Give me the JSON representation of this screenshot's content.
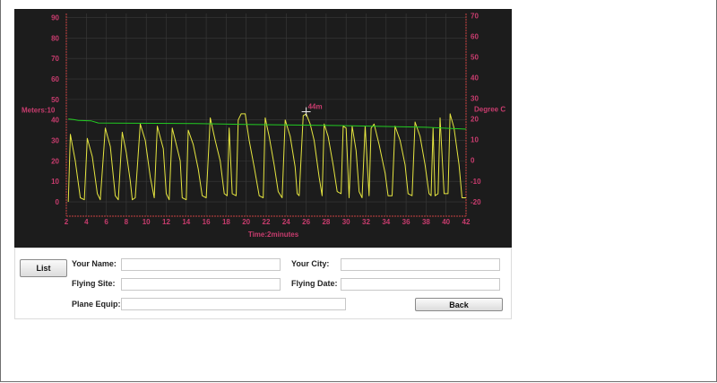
{
  "chart_data": {
    "type": "line",
    "left_axis": {
      "label": "Meters:10",
      "ticks": [
        0,
        10,
        20,
        30,
        40,
        50,
        60,
        70,
        80,
        90
      ],
      "range": [
        -7,
        92
      ]
    },
    "right_axis": {
      "label": "Degree C",
      "ticks": [
        -20,
        -10,
        0,
        10,
        20,
        30,
        40,
        50,
        60,
        70
      ],
      "range": [
        -27,
        71
      ]
    },
    "x_axis": {
      "label": "Time:2minutes",
      "ticks": [
        2,
        4,
        6,
        8,
        10,
        12,
        14,
        16,
        18,
        20,
        22,
        24,
        26,
        28,
        30,
        32,
        34,
        36,
        38,
        40,
        42
      ],
      "range": [
        2,
        42
      ]
    },
    "grid": true,
    "annotation": {
      "text": "44m",
      "x": 26.0,
      "y": 44
    },
    "series": [
      {
        "axis": "left",
        "color": "#e6e640",
        "points": [
          [
            2.2,
            0
          ],
          [
            2.4,
            33
          ],
          [
            2.9,
            20
          ],
          [
            3.4,
            2
          ],
          [
            3.8,
            1
          ],
          [
            4.1,
            31
          ],
          [
            4.6,
            22
          ],
          [
            5.1,
            4
          ],
          [
            5.4,
            1
          ],
          [
            5.9,
            36
          ],
          [
            6.4,
            27
          ],
          [
            6.9,
            3
          ],
          [
            7.2,
            1
          ],
          [
            7.6,
            34
          ],
          [
            8.0,
            24
          ],
          [
            8.4,
            10
          ],
          [
            8.6,
            1
          ],
          [
            8.9,
            2
          ],
          [
            9.4,
            38
          ],
          [
            9.9,
            30
          ],
          [
            10.4,
            12
          ],
          [
            10.8,
            2
          ],
          [
            11.1,
            37
          ],
          [
            11.7,
            26
          ],
          [
            12.0,
            4
          ],
          [
            12.3,
            1
          ],
          [
            12.6,
            36
          ],
          [
            13.0,
            28
          ],
          [
            13.4,
            20
          ],
          [
            13.6,
            2
          ],
          [
            14.0,
            1
          ],
          [
            14.2,
            35
          ],
          [
            14.7,
            28
          ],
          [
            15.2,
            16
          ],
          [
            15.6,
            3
          ],
          [
            16.0,
            2
          ],
          [
            16.4,
            41
          ],
          [
            16.9,
            30
          ],
          [
            17.4,
            20
          ],
          [
            17.8,
            4
          ],
          [
            18.1,
            3
          ],
          [
            18.3,
            36
          ],
          [
            18.6,
            4
          ],
          [
            19.0,
            3
          ],
          [
            19.2,
            40
          ],
          [
            19.5,
            43
          ],
          [
            19.9,
            43
          ],
          [
            20.3,
            30
          ],
          [
            20.8,
            17
          ],
          [
            21.3,
            3
          ],
          [
            21.7,
            2
          ],
          [
            21.9,
            41
          ],
          [
            22.3,
            32
          ],
          [
            22.8,
            18
          ],
          [
            23.2,
            5
          ],
          [
            23.6,
            2
          ],
          [
            23.9,
            40
          ],
          [
            24.4,
            32
          ],
          [
            24.9,
            17
          ],
          [
            25.1,
            4
          ],
          [
            25.3,
            3
          ],
          [
            25.7,
            42
          ],
          [
            26.0,
            43
          ],
          [
            26.4,
            38
          ],
          [
            26.8,
            30
          ],
          [
            27.3,
            12
          ],
          [
            27.6,
            3
          ],
          [
            27.8,
            38
          ],
          [
            28.2,
            32
          ],
          [
            28.7,
            18
          ],
          [
            29.1,
            5
          ],
          [
            29.5,
            4
          ],
          [
            29.7,
            37
          ],
          [
            30.0,
            36
          ],
          [
            30.3,
            2
          ],
          [
            30.6,
            37
          ],
          [
            31.0,
            25
          ],
          [
            31.3,
            5
          ],
          [
            31.6,
            2
          ],
          [
            31.9,
            37
          ],
          [
            32.3,
            3
          ],
          [
            32.5,
            36
          ],
          [
            32.8,
            38
          ],
          [
            33.3,
            28
          ],
          [
            33.9,
            14
          ],
          [
            34.2,
            3
          ],
          [
            34.6,
            3
          ],
          [
            34.9,
            37
          ],
          [
            35.4,
            30
          ],
          [
            35.9,
            18
          ],
          [
            36.2,
            4
          ],
          [
            36.6,
            3
          ],
          [
            36.9,
            39
          ],
          [
            37.4,
            32
          ],
          [
            37.9,
            18
          ],
          [
            38.3,
            4
          ],
          [
            38.5,
            3
          ],
          [
            38.7,
            36
          ],
          [
            38.9,
            3
          ],
          [
            39.2,
            4
          ],
          [
            39.4,
            41
          ],
          [
            39.8,
            4
          ],
          [
            40.2,
            4
          ],
          [
            40.4,
            43
          ],
          [
            40.8,
            36
          ],
          [
            41.3,
            18
          ],
          [
            41.6,
            2
          ],
          [
            42.0,
            2
          ]
        ]
      },
      {
        "axis": "left",
        "color": "#22cc22",
        "points": [
          [
            2.2,
            40.5
          ],
          [
            2.7,
            40.2
          ],
          [
            3.2,
            39.8
          ],
          [
            4.5,
            39.5
          ],
          [
            5.2,
            38.5
          ],
          [
            15,
            38.2
          ],
          [
            20,
            37.8
          ],
          [
            30,
            37.2
          ],
          [
            38,
            36.4
          ],
          [
            42,
            35.5
          ]
        ]
      }
    ]
  },
  "form": {
    "list_button": "List",
    "back_button": "Back",
    "name_label": "Your Name:",
    "name_value": "",
    "city_label": "Your City:",
    "city_value": "",
    "site_label": "Flying Site:",
    "site_value": "",
    "date_label": "Flying Date:",
    "date_value": "",
    "equip_label": "Plane Equip:",
    "equip_value": ""
  },
  "colors": {
    "chart_bg": "#1c1c1c",
    "axis_text": "#c83c6e",
    "grid": "#3a3a3a",
    "axis_line": "#c84040"
  }
}
